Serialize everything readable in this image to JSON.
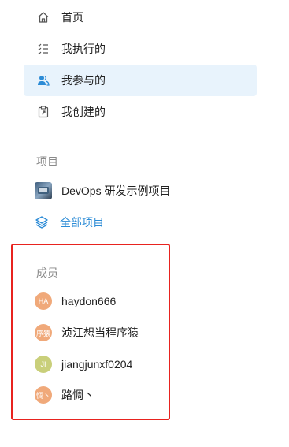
{
  "nav": {
    "items": [
      {
        "label": "首页",
        "icon": "home-icon"
      },
      {
        "label": "我执行的",
        "icon": "task-list-icon"
      },
      {
        "label": "我参与的",
        "icon": "people-icon",
        "active": true
      },
      {
        "label": "我创建的",
        "icon": "clipboard-edit-icon"
      }
    ]
  },
  "projects": {
    "title": "项目",
    "items": [
      {
        "label": "DevOps 研发示例项目",
        "icon": "project-thumbnail"
      }
    ],
    "all_label": "全部项目",
    "all_icon": "layers-icon"
  },
  "members": {
    "title": "成员",
    "items": [
      {
        "initials": "HA",
        "name": "haydon666",
        "color": "#f0a97a"
      },
      {
        "initials": "序猿",
        "name": "浈江想当程序猿",
        "color": "#f0a97a"
      },
      {
        "initials": "JI",
        "name": "jiangjunxf0204",
        "color": "#c9cf7a"
      },
      {
        "initials": "惆丶",
        "name": "路惆丶",
        "color": "#f0a97a"
      }
    ]
  },
  "colors": {
    "accent": "#2b8bd6",
    "active_bg": "#e8f3fc",
    "highlight_border": "#e8231f",
    "section_title": "#8a8a8a"
  }
}
